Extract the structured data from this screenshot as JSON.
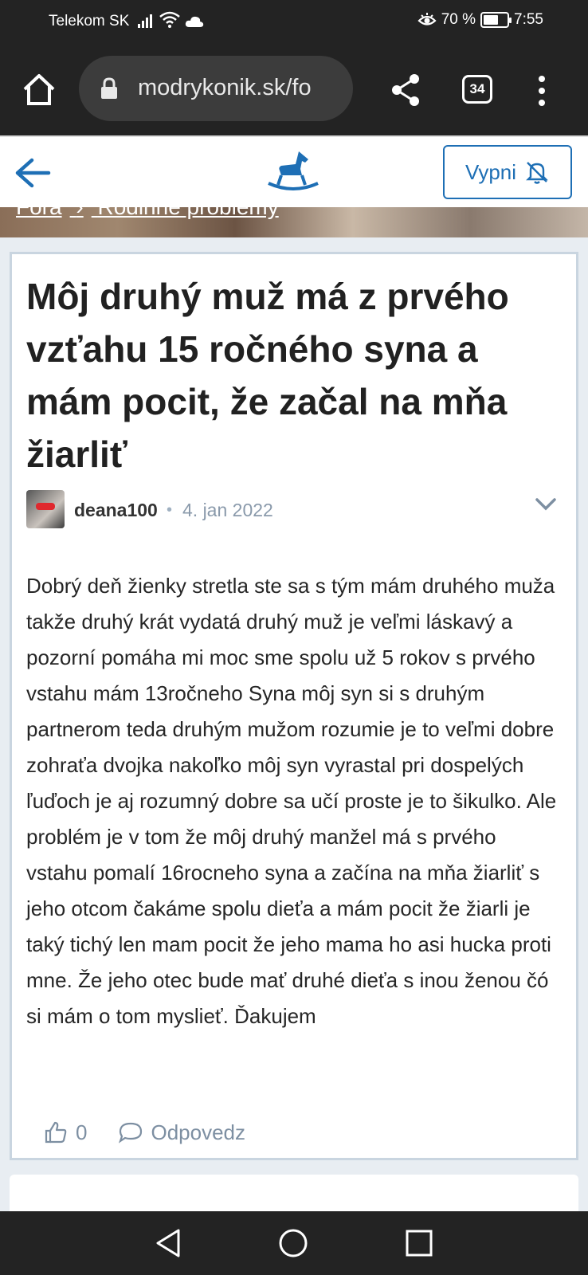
{
  "status": {
    "carrier": "Telekom SK",
    "battery_pct_text": "70 %",
    "battery_level": 0.7,
    "time": "7:55"
  },
  "browser": {
    "url": "modrykonik.sk/fo",
    "tab_count": "34"
  },
  "site_header": {
    "notify_button_label": "Vypni"
  },
  "breadcrumb": {
    "items": [
      "Fóra",
      "›",
      "Rodinné problémy"
    ]
  },
  "post": {
    "title": "Môj druhý muž má z prvého vzťahu 15 ročného syna a mám pocit, že začal na mňa žiarliť",
    "author": "deana100",
    "separator": "•",
    "date": "4. jan 2022",
    "body": "Dobrý deň žienky stretla ste sa s tým mám druhého muža takže druhý krát vydatá druhý muž je veľmi láskavý a pozorní pomáha mi moc sme spolu už 5 rokov s prvého vstahu mám 13ročneho Syna môj syn si s druhým partnerom teda druhým mužom rozumie je to veľmi dobre zohraťa dvojka nakoľko môj syn vyrastal pri dospelých ľuďoch je aj rozumný dobre sa učí proste je to šikulko. Ale problém je v tom že môj druhý manžel má s prvého vstahu pomalí 16rocneho syna a začína na mňa žiarliť s jeho otcom čakáme spolu dieťa a mám pocit že žiarli je taký tichý len mam pocit že jeho mama ho asi hucka proti mne. Že jeho otec bude mať druhé dieťa s inou ženou čó si mám o tom myslieť. Ďakujem",
    "like_count": "0",
    "reply_label": "Odpovedz"
  },
  "colors": {
    "accent": "#1e6fb5",
    "muted": "#7d8fa2",
    "card_border": "#c9d5e0"
  },
  "icons": [
    "signal-icon",
    "wifi-icon",
    "cloud-icon",
    "eye-icon",
    "battery-icon",
    "home-icon",
    "lock-icon",
    "share-icon",
    "tabs-icon",
    "overflow-menu-icon",
    "back-arrow-icon",
    "rocking-horse-logo",
    "bell-off-icon",
    "chevron-down-icon",
    "thumbs-up-icon",
    "comment-icon",
    "nav-back-icon",
    "nav-home-icon",
    "nav-recents-icon"
  ]
}
